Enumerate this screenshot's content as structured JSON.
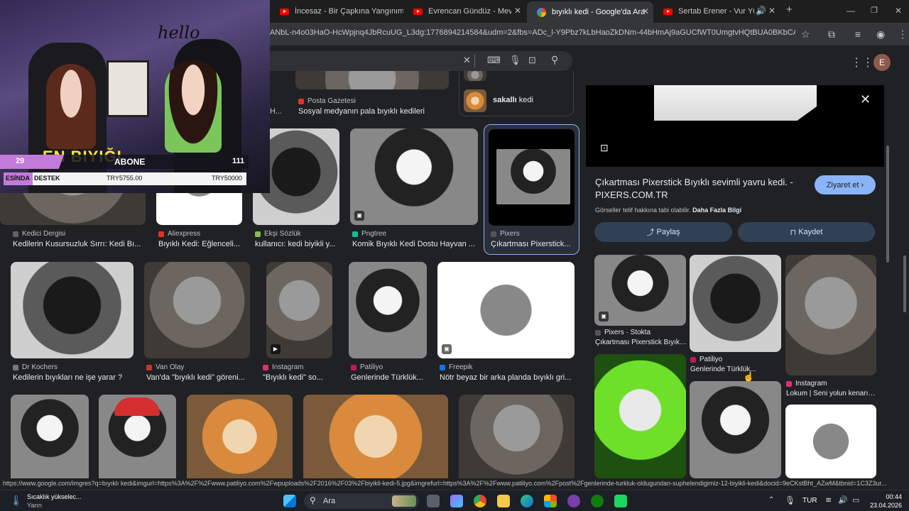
{
  "tabs": [
    {
      "label": "İncesaz - Bir Çapkına Yangınım",
      "icon": "youtube-icon"
    },
    {
      "label": "Evrencan Gündüz - Mevsim Çiçe",
      "icon": "youtube-icon"
    },
    {
      "label": "bıyıklı kedi - Google'da Ara",
      "icon": "google-icon"
    },
    {
      "label": "Sertab Erener - Vur Yüreğim",
      "icon": "youtube-icon"
    }
  ],
  "address": {
    "url": "ANbL-n4o03HaO-HcWpjnq4JbRcuUG_L3dg:1776894214584&udm=2&fbs=ADc_l-Y9Pbz7kLbHaoZkDNm-44bHmAj9aGUCfWT0UmgtvHQtBUA0BKbCAH0pNX..."
  },
  "profile_letter": "E",
  "top_partial": {
    "partial_label": "H...",
    "source": "Posta Gazetesi",
    "title": "Sosyal medyanın pala bıyıklı kedileri",
    "related": "sakallı",
    "related_bold": "kedi"
  },
  "results_row1": [
    {
      "source": "Kedici Dergisi",
      "title": "Kedilerin Kusursuzluk Sırrı: Kedi Bı...",
      "color": "#5f6368"
    },
    {
      "source": "Aliexpress",
      "title": "Bıyıklı Kedi: Eğlenceli...",
      "color": "#e43225"
    },
    {
      "source": "Ekşi Sözlük",
      "title": "kullanıcı: kedi biyikli y...",
      "color": "#81c14b"
    },
    {
      "source": "Pngtree",
      "title": "Komik Bıyıklı Kedi Dostu Hayvan ...",
      "color": "#1abc9c"
    },
    {
      "source": "Pixers",
      "title": "Çıkartması Pixerstick...",
      "color": "#555555"
    }
  ],
  "results_row2": [
    {
      "source": "Dr Kochers",
      "title": "Kedilerin bıyıkları ne işe yarar ?",
      "color": "#777777"
    },
    {
      "source": "Van Olay",
      "title": "Van'da \"bıyıklı kedi\" göreni...",
      "color": "#c0392b"
    },
    {
      "source": "Instagram",
      "title": "\"Bıyıklı kedi\" so...",
      "color": "#e1306c"
    },
    {
      "source": "Patiliyo",
      "title": "Genlerinde Türklük...",
      "color": "#c2185b"
    },
    {
      "source": "Freepik",
      "title": "Nötr beyaz bir arka planda bıyıklı gri...",
      "color": "#1273eb"
    }
  ],
  "panel": {
    "title": "Çıkartması Pixerstick Bıyıklı sevimli yavru kedi. - PIXERS.COM.TR",
    "visit_label": "Ziyaret et",
    "copyright": "Görseller telif hakkına tabi olabilir.",
    "more_info": "Daha Fazla Bilgi",
    "share_label": "Paylaş",
    "save_label": "Kaydet",
    "related": [
      {
        "source": "Pixers · Stokta",
        "title": "Çıkartması Pixerstick Bıyıklı..."
      },
      {
        "source": "Patiliyo",
        "title": "Genlerinde Türklük..."
      },
      {
        "source": "Instagram",
        "title": "Lokum | Seni yolun kenarın..."
      }
    ]
  },
  "overlay": {
    "hello": "hello",
    "goal_current": "29",
    "goal_label": "ABONE",
    "goal_target": "111",
    "banner_text": "EN BIYIĞI",
    "donate_prefix": "ESİNDA",
    "donate_label": "DESTEK",
    "donate_current": "TRY5755.00",
    "donate_target": "TRY50000"
  },
  "status_url": "https://www.google.com/imgres?q=bıyıklı kedi&imgurl=https%3A%2F%2Fwww.patiliyo.com%2Fwpuploads%2F2016%2F03%2Fbiyikli-kedi-5.jpg&imgrefurl=https%3A%2F%2Fwww.patiliyo.com%2Fpost%2Fgenlerinde-turkluk-oldugundan-suphelendigimiz-12-biyikli-kedi&docid=9eCKstBht_AZwM&tbnid=1C3Z3ur...",
  "taskbar": {
    "weather_title": "Sıcaklık yükselec...",
    "weather_sub": "Yarın",
    "search_label": "Ara",
    "language": "TUR",
    "time": "00:44",
    "date": "23.04.2026"
  }
}
